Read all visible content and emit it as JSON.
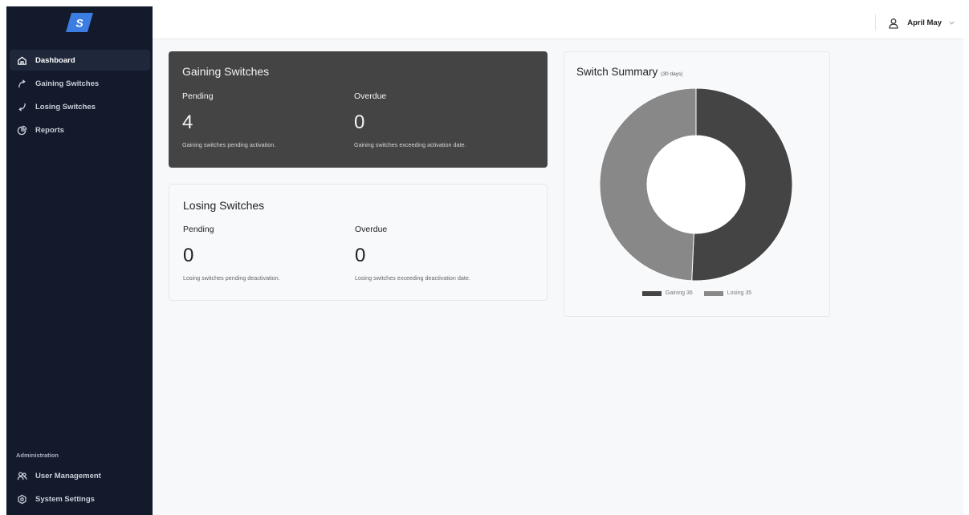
{
  "brand": {
    "logo_letter": "S",
    "logo_color": "#3b7de0"
  },
  "sidebar": {
    "items": [
      {
        "label": "Dashboard",
        "icon": "home-icon",
        "active": true
      },
      {
        "label": "Gaining Switches",
        "icon": "arrow-up-curve-icon",
        "active": false
      },
      {
        "label": "Losing Switches",
        "icon": "arrow-down-curve-icon",
        "active": false
      },
      {
        "label": "Reports",
        "icon": "pie-chart-icon",
        "active": false
      }
    ],
    "admin_label": "Administration",
    "admin_items": [
      {
        "label": "User Management",
        "icon": "users-icon"
      },
      {
        "label": "System Settings",
        "icon": "gear-icon"
      }
    ]
  },
  "header": {
    "user_name": "April May"
  },
  "gaining": {
    "title": "Gaining Switches",
    "pending_label": "Pending",
    "pending_value": "4",
    "pending_desc": "Gaining switches pending activation.",
    "overdue_label": "Overdue",
    "overdue_value": "0",
    "overdue_desc": "Gaining switches exceeding activation date."
  },
  "losing": {
    "title": "Losing Switches",
    "pending_label": "Pending",
    "pending_value": "0",
    "pending_desc": "Losing switches pending deactivation.",
    "overdue_label": "Overdue",
    "overdue_value": "0",
    "overdue_desc": "Losing switches exceeding deactivation date."
  },
  "summary": {
    "title": "Switch Summary",
    "subtitle": "(30 days)"
  },
  "chart_data": {
    "type": "pie",
    "donut": true,
    "title": "Switch Summary",
    "subtitle": "(30 days)",
    "legend_position": "bottom",
    "series": [
      {
        "name": "Gaining",
        "value": 36,
        "color": "#444444",
        "legend_text": "Gaining 36"
      },
      {
        "name": "Losing",
        "value": 35,
        "color": "#888888",
        "legend_text": "Losing 35"
      }
    ]
  }
}
